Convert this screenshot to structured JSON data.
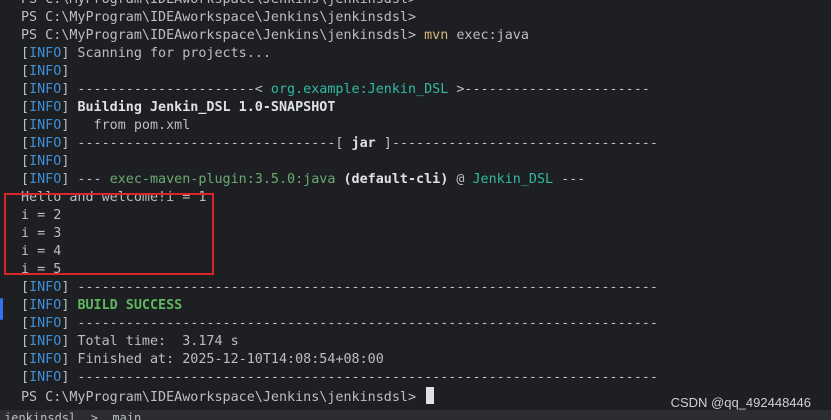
{
  "terminal": {
    "lines": [
      {
        "parts": [
          {
            "text": "PS C:\\MyProgram\\IDEAworkspace\\Jenkins\\jenkinsdsl>",
            "cls": "dim"
          }
        ]
      },
      {
        "parts": [
          {
            "text": "PS C:\\MyProgram\\IDEAworkspace\\Jenkins\\jenkinsdsl>",
            "cls": "dim"
          }
        ]
      },
      {
        "parts": [
          {
            "text": "PS C:\\MyProgram\\IDEAworkspace\\Jenkins\\jenkinsdsl> ",
            "cls": "dim"
          },
          {
            "text": "mvn",
            "cls": "cmd"
          },
          {
            "text": " exec:java",
            "cls": "dim"
          }
        ]
      },
      {
        "parts": [
          {
            "text": "[",
            "cls": "dim"
          },
          {
            "text": "INFO",
            "cls": "info-tag"
          },
          {
            "text": "] Scanning for projects...",
            "cls": "dim"
          }
        ]
      },
      {
        "parts": [
          {
            "text": "[",
            "cls": "dim"
          },
          {
            "text": "INFO",
            "cls": "info-tag"
          },
          {
            "text": "]",
            "cls": "dim"
          }
        ]
      },
      {
        "parts": [
          {
            "text": "[",
            "cls": "dim"
          },
          {
            "text": "INFO",
            "cls": "info-tag"
          },
          {
            "text": "] ----------------------< ",
            "cls": "dim"
          },
          {
            "text": "org.example:Jenkin_DSL",
            "cls": "teal"
          },
          {
            "text": " >-----------------------",
            "cls": "dim"
          }
        ]
      },
      {
        "parts": [
          {
            "text": "[",
            "cls": "dim"
          },
          {
            "text": "INFO",
            "cls": "info-tag"
          },
          {
            "text": "] ",
            "cls": "dim"
          },
          {
            "text": "Building Jenkin_DSL 1.0-SNAPSHOT",
            "cls": "bold"
          }
        ]
      },
      {
        "parts": [
          {
            "text": "[",
            "cls": "dim"
          },
          {
            "text": "INFO",
            "cls": "info-tag"
          },
          {
            "text": "]   from pom.xml",
            "cls": "dim"
          }
        ]
      },
      {
        "parts": [
          {
            "text": "[",
            "cls": "dim"
          },
          {
            "text": "INFO",
            "cls": "info-tag"
          },
          {
            "text": "] --------------------------------[ ",
            "cls": "dim"
          },
          {
            "text": "jar",
            "cls": "bold"
          },
          {
            "text": " ]---------------------------------",
            "cls": "dim"
          }
        ]
      },
      {
        "parts": [
          {
            "text": "[",
            "cls": "dim"
          },
          {
            "text": "INFO",
            "cls": "info-tag"
          },
          {
            "text": "]",
            "cls": "dim"
          }
        ]
      },
      {
        "parts": [
          {
            "text": "[",
            "cls": "dim"
          },
          {
            "text": "INFO",
            "cls": "info-tag"
          },
          {
            "text": "] --- ",
            "cls": "dim"
          },
          {
            "text": "exec-maven-plugin:3.5.0:java",
            "cls": "green"
          },
          {
            "text": " ",
            "cls": "dim"
          },
          {
            "text": "(default-cli)",
            "cls": "bold"
          },
          {
            "text": " @ ",
            "cls": "dim"
          },
          {
            "text": "Jenkin_DSL",
            "cls": "teal"
          },
          {
            "text": " ---",
            "cls": "dim"
          }
        ]
      },
      {
        "parts": [
          {
            "text": "Hello and welcome!i = 1",
            "cls": "dim"
          }
        ]
      },
      {
        "parts": [
          {
            "text": "i = 2",
            "cls": "dim"
          }
        ]
      },
      {
        "parts": [
          {
            "text": "i = 3",
            "cls": "dim"
          }
        ]
      },
      {
        "parts": [
          {
            "text": "i = 4",
            "cls": "dim"
          }
        ]
      },
      {
        "parts": [
          {
            "text": "i = 5",
            "cls": "dim"
          }
        ]
      },
      {
        "parts": [
          {
            "text": "[",
            "cls": "dim"
          },
          {
            "text": "INFO",
            "cls": "info-tag"
          },
          {
            "text": "] ------------------------------------------------------------------------",
            "cls": "dim"
          }
        ]
      },
      {
        "parts": [
          {
            "text": "[",
            "cls": "dim"
          },
          {
            "text": "INFO",
            "cls": "info-tag"
          },
          {
            "text": "] ",
            "cls": "dim"
          },
          {
            "text": "BUILD SUCCESS",
            "cls": "success"
          }
        ]
      },
      {
        "parts": [
          {
            "text": "[",
            "cls": "dim"
          },
          {
            "text": "INFO",
            "cls": "info-tag"
          },
          {
            "text": "] ------------------------------------------------------------------------",
            "cls": "dim"
          }
        ]
      },
      {
        "parts": [
          {
            "text": "[",
            "cls": "dim"
          },
          {
            "text": "INFO",
            "cls": "info-tag"
          },
          {
            "text": "] Total time:  3.174 s",
            "cls": "dim"
          }
        ]
      },
      {
        "parts": [
          {
            "text": "[",
            "cls": "dim"
          },
          {
            "text": "INFO",
            "cls": "info-tag"
          },
          {
            "text": "] Finished at: 2025-12-10T14:08:54+08:00",
            "cls": "dim"
          }
        ]
      },
      {
        "parts": [
          {
            "text": "[",
            "cls": "dim"
          },
          {
            "text": "INFO",
            "cls": "info-tag"
          },
          {
            "text": "] ------------------------------------------------------------------------",
            "cls": "dim"
          }
        ]
      },
      {
        "parts": [
          {
            "text": "PS C:\\MyProgram\\IDEAworkspace\\Jenkins\\jenkinsdsl> ",
            "cls": "dim"
          }
        ],
        "cursor": true
      }
    ]
  },
  "status_bar": {
    "partial_text": "jenkinsdsl  >  main"
  },
  "watermark": {
    "text": "CSDN @qq_492448446"
  },
  "colors": {
    "background": "#1e1f22",
    "info_tag": "#3d8fd6",
    "command": "#d5b778",
    "plugin_green": "#6aab73",
    "artifact_teal": "#2fbaa3",
    "success_green": "#5fb85f",
    "highlight_red": "#d8262b"
  }
}
